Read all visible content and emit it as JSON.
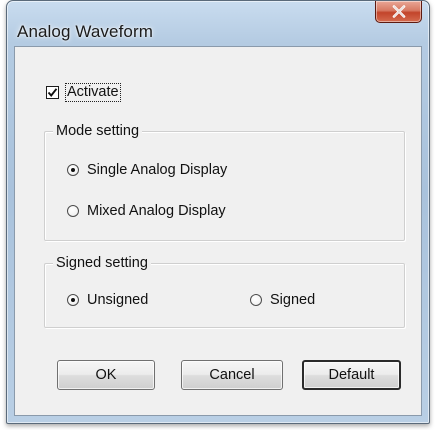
{
  "window": {
    "title": "Analog Waveform",
    "close_icon": "close-x-icon"
  },
  "activate": {
    "label": "Activate",
    "checked": true
  },
  "mode_setting": {
    "legend": "Mode setting",
    "options": [
      {
        "label": "Single Analog Display",
        "selected": true
      },
      {
        "label": "Mixed Analog Display",
        "selected": false
      }
    ]
  },
  "signed_setting": {
    "legend": "Signed setting",
    "options": [
      {
        "label": "Unsigned",
        "selected": true
      },
      {
        "label": "Signed",
        "selected": false
      }
    ]
  },
  "buttons": {
    "ok": "OK",
    "cancel": "Cancel",
    "default": "Default"
  },
  "colors": {
    "frame": "#b4cbe2",
    "close_button": "#c2442a",
    "client": "#f0f0f0"
  }
}
